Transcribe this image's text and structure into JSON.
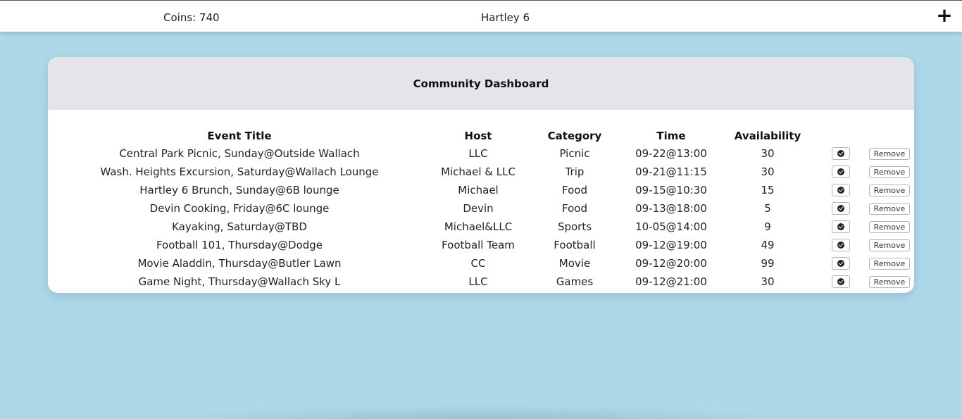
{
  "header": {
    "coins": "Coins: 740",
    "building": "Hartley 6",
    "add_label": "+"
  },
  "dashboard": {
    "title": "Community Dashboard",
    "columns": [
      "Event Title",
      "Host",
      "Category",
      "Time",
      "Availability"
    ],
    "remove_label": "Remove",
    "rows": [
      {
        "title": "Central Park Picnic, Sunday@Outside Wallach",
        "host": "LLC",
        "category": "Picnic",
        "time": "09-22@13:00",
        "availability": "30"
      },
      {
        "title": "Wash. Heights Excursion, Saturday@Wallach Lounge",
        "host": "Michael & LLC",
        "category": "Trip",
        "time": "09-21@11:15",
        "availability": "30"
      },
      {
        "title": "Hartley 6 Brunch, Sunday@6B lounge",
        "host": "Michael",
        "category": "Food",
        "time": "09-15@10:30",
        "availability": "15"
      },
      {
        "title": "Devin Cooking, Friday@6C lounge",
        "host": "Devin",
        "category": "Food",
        "time": "09-13@18:00",
        "availability": "5"
      },
      {
        "title": "Kayaking, Saturday@TBD",
        "host": "Michael&LLC",
        "category": "Sports",
        "time": "10-05@14:00",
        "availability": "9"
      },
      {
        "title": "Football 101, Thursday@Dodge",
        "host": "Football Team",
        "category": "Football",
        "time": "09-12@19:00",
        "availability": "49"
      },
      {
        "title": "Movie Aladdin, Thursday@Butler Lawn",
        "host": "CC",
        "category": "Movie",
        "time": "09-12@20:00",
        "availability": "99"
      },
      {
        "title": "Game Night, Thursday@Wallach Sky L",
        "host": "LLC",
        "category": "Games",
        "time": "09-12@21:00",
        "availability": "30"
      }
    ]
  },
  "colors": {
    "background": "#add8ea",
    "card": "#ffffff",
    "card_header": "#e3e5e8"
  },
  "icons": {
    "confirm": "check-circle-icon",
    "add": "plus-icon"
  }
}
